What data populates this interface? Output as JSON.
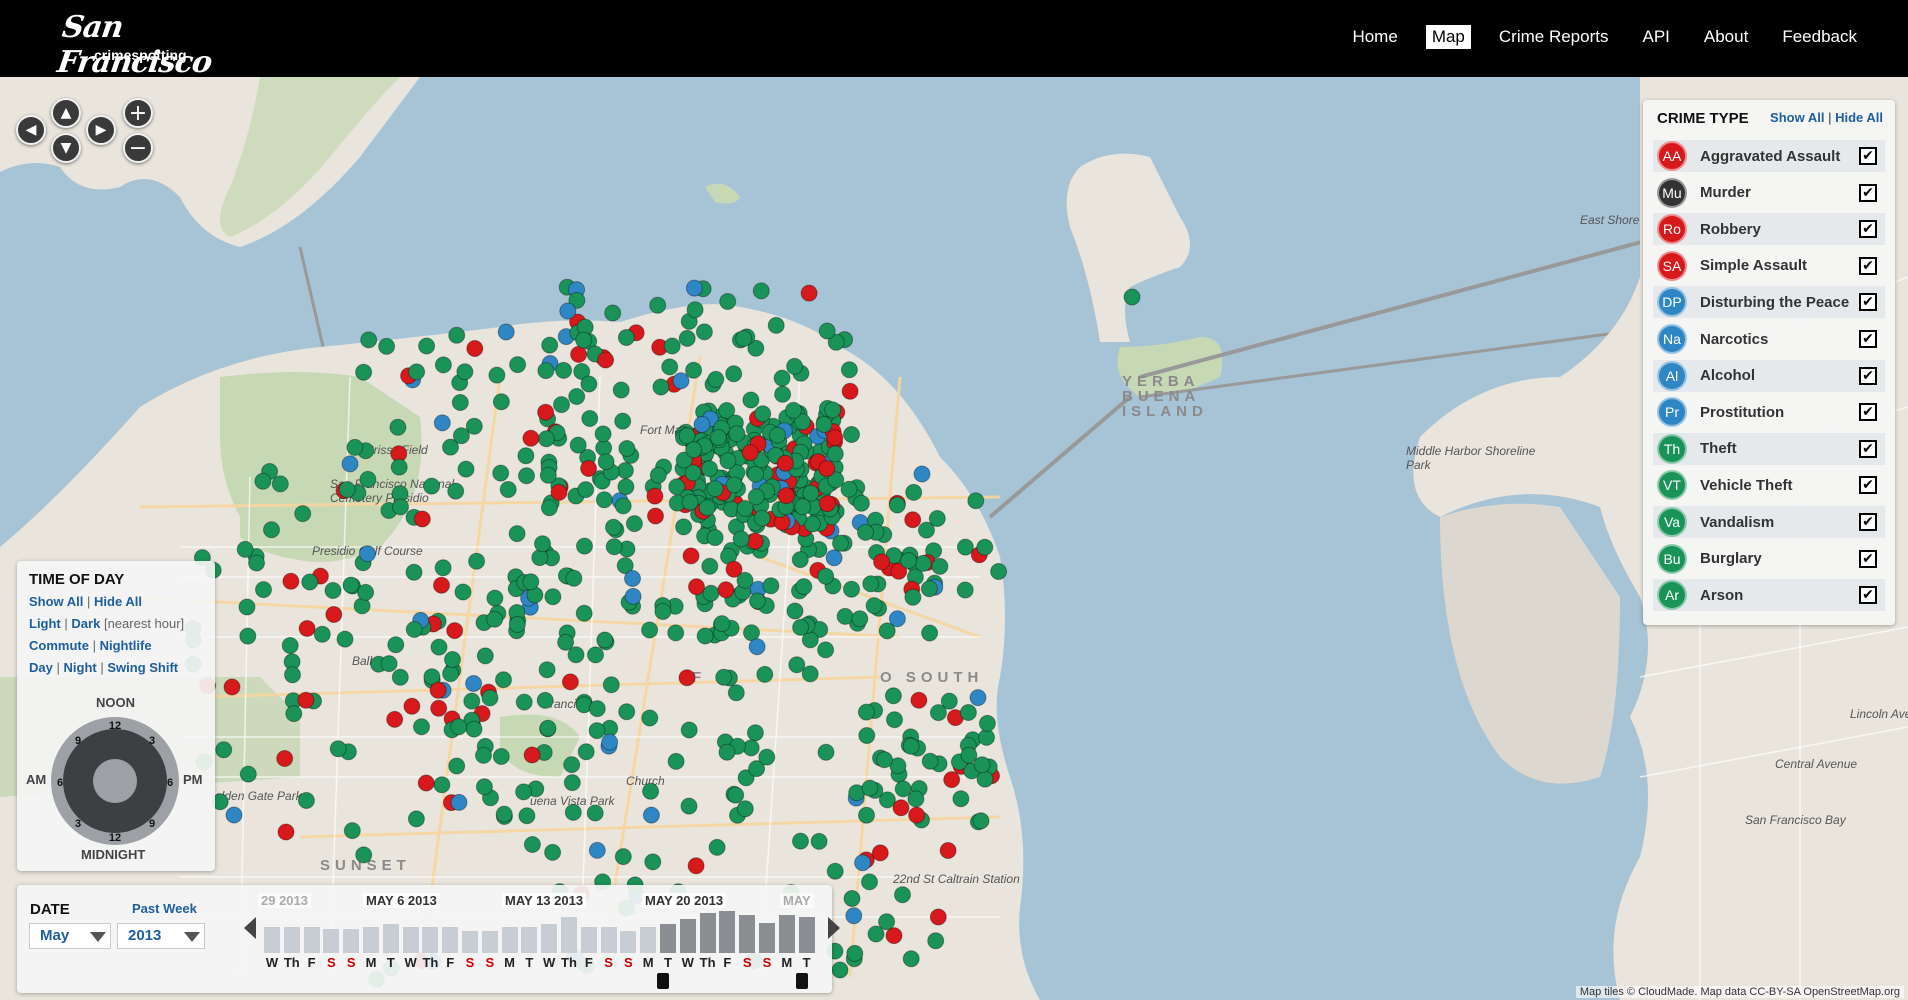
{
  "header": {
    "logo_city": "San Francisco",
    "logo_sub": "crimespotting",
    "nav": [
      {
        "label": "Home",
        "active": false
      },
      {
        "label": "Map",
        "active": true
      },
      {
        "label": "Crime Reports",
        "active": false
      },
      {
        "label": "API",
        "active": false
      },
      {
        "label": "About",
        "active": false
      },
      {
        "label": "Feedback",
        "active": false
      }
    ]
  },
  "map_controls": {
    "pan_up": "▲",
    "pan_down": "▼",
    "pan_left": "◀",
    "pan_right": "▶",
    "zoom_in": "+",
    "zoom_out": "−"
  },
  "map_labels": {
    "crissy_field": "Crissy Field",
    "presidio_cemetery": "San Francisco National Cemetery Presidio",
    "presidio_golf": "Presidio Golf Course",
    "fort_mason": "Fort Mason",
    "yerba_buena": "YERBA BUENA ISLAND",
    "middle_harbor": "Middle Harbor Shoreline Park",
    "east_shore": "East Shore",
    "sf_bay": "San Francisco Bay",
    "financial": "F",
    "south": "O SOUTH",
    "golden_gate_park": "olden Gate Park",
    "buena_vista": "uena Vista Park",
    "sunset": "SUNSET",
    "caltrain": "22nd St Caltrain Station",
    "balboa": "Balboa",
    "francisco": "rancisco",
    "church": "Church",
    "lincoln": "Lincoln Ave",
    "central": "Central Avenue"
  },
  "crime_type": {
    "title": "CRIME TYPE",
    "show_all": "Show All",
    "hide_all": "Hide All",
    "separator": "|",
    "types": [
      {
        "abbr": "AA",
        "label": "Aggravated Assault",
        "color": "#d7191c",
        "checked": true
      },
      {
        "abbr": "Mu",
        "label": "Murder",
        "color": "#333333",
        "checked": true
      },
      {
        "abbr": "Ro",
        "label": "Robbery",
        "color": "#d7191c",
        "checked": true
      },
      {
        "abbr": "SA",
        "label": "Simple Assault",
        "color": "#d7191c",
        "checked": true
      },
      {
        "abbr": "DP",
        "label": "Disturbing the Peace",
        "color": "#2f86c4",
        "checked": true
      },
      {
        "abbr": "Na",
        "label": "Narcotics",
        "color": "#2f86c4",
        "checked": true
      },
      {
        "abbr": "Al",
        "label": "Alcohol",
        "color": "#2f86c4",
        "checked": true
      },
      {
        "abbr": "Pr",
        "label": "Prostitution",
        "color": "#2f86c4",
        "checked": true
      },
      {
        "abbr": "Th",
        "label": "Theft",
        "color": "#1a9358",
        "checked": true
      },
      {
        "abbr": "VT",
        "label": "Vehicle Theft",
        "color": "#1a9358",
        "checked": true
      },
      {
        "abbr": "Va",
        "label": "Vandalism",
        "color": "#1a9358",
        "checked": true
      },
      {
        "abbr": "Bu",
        "label": "Burglary",
        "color": "#1a9358",
        "checked": true
      },
      {
        "abbr": "Ar",
        "label": "Arson",
        "color": "#1a9358",
        "checked": true
      }
    ],
    "check_glyph": "✔"
  },
  "time_of_day": {
    "title": "TIME OF DAY",
    "show_all": "Show All",
    "hide_all": "Hide All",
    "light": "Light",
    "dark": "Dark",
    "nearest_hour": "[nearest hour]",
    "commute": "Commute",
    "nightlife": "Nightlife",
    "day": "Day",
    "night": "Night",
    "swing_shift": "Swing Shift",
    "sep": "|",
    "noon": "NOON",
    "midnight": "MIDNIGHT",
    "am": "AM",
    "pm": "PM",
    "clock_numbers": [
      "12",
      "3",
      "6",
      "9",
      "12",
      "3",
      "6",
      "9"
    ]
  },
  "date": {
    "title": "DATE",
    "past_week": "Past Week",
    "month": "May",
    "year": "2013",
    "week_labels": [
      "29 2013",
      "MAY 6 2013",
      "MAY 13 2013",
      "MAY 20 2013",
      "MAY"
    ],
    "days": [
      "W",
      "Th",
      "F",
      "S",
      "S",
      "M",
      "T",
      "W",
      "Th",
      "F",
      "S",
      "S",
      "M",
      "T",
      "W",
      "Th",
      "F",
      "S",
      "S",
      "M",
      "T",
      "W",
      "Th",
      "F",
      "S",
      "S",
      "M",
      "T"
    ],
    "day_counts": [
      0.62,
      0.62,
      0.62,
      0.56,
      0.56,
      0.62,
      0.7,
      0.62,
      0.62,
      0.62,
      0.52,
      0.52,
      0.62,
      0.62,
      0.7,
      0.86,
      0.62,
      0.62,
      0.52,
      0.62,
      0.7,
      0.8,
      0.96,
      1.0,
      0.9,
      0.72,
      0.9,
      0.85
    ],
    "selected_from_index": 20,
    "selected_to_index": 27
  },
  "attribution": "Map tiles © CloudMade. Map data CC-BY-SA OpenStreetMap.org",
  "colors": {
    "red": "#d7191c",
    "blue": "#2f86c4",
    "green": "#1a9358",
    "water": "#a7c3d6",
    "land": "#e9e5dc",
    "park": "#c7d8b5"
  }
}
